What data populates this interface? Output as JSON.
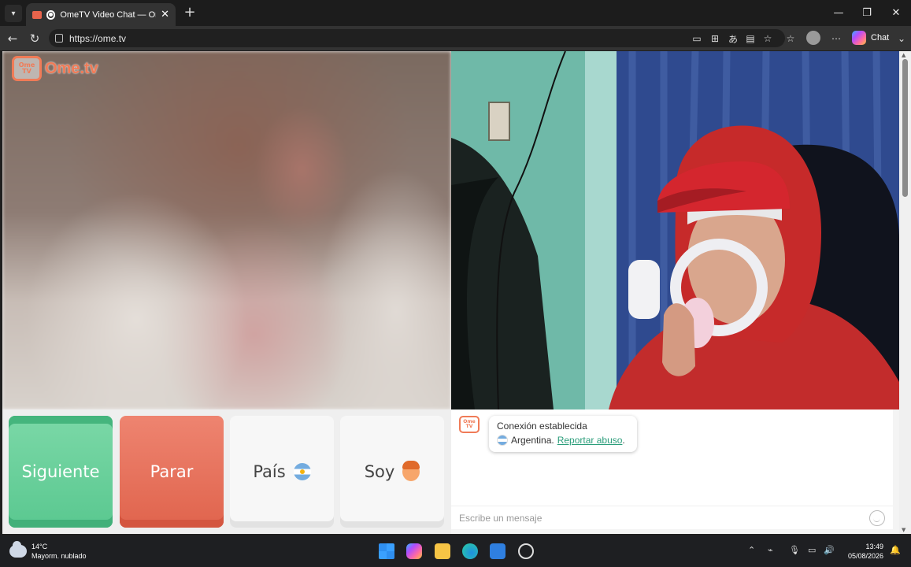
{
  "browser": {
    "tab_title": "OmeTV Video Chat — Omegle",
    "url": "https://ome.tv",
    "copilot_label": "Chat"
  },
  "site": {
    "brand_tv": "Ome TV",
    "brand_word": "Ome.tv"
  },
  "controls": {
    "next_label": "Siguiente",
    "stop_label": "Parar",
    "country_label": "País",
    "gender_label": "Soy"
  },
  "chat": {
    "logo_text": "Ome TV",
    "status": "Conexión establecida",
    "country": "Argentina.",
    "report_link": "Reportar abuso",
    "report_suffix": ".",
    "input_placeholder": "Escribe un mensaje"
  },
  "taskbar": {
    "weather_temp": "14°C",
    "weather_desc": "Mayorm. nublado",
    "time": "13:49",
    "date": "05/08/2026"
  },
  "colors": {
    "accent_green": "#5ac890",
    "accent_red": "#e0644d",
    "brand_orange": "#f07b57",
    "link_green": "#2a9d7a"
  }
}
